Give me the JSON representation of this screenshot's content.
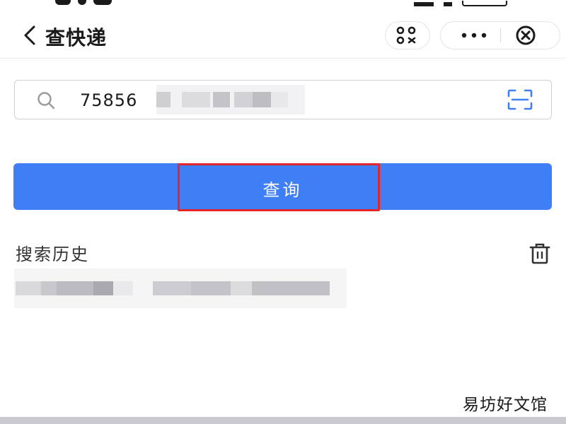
{
  "header": {
    "title": "查快递",
    "back_icon": "chevron-left-icon",
    "mini_program_icon": "grid-scan-icon",
    "more_icon": "more-dots-icon",
    "close_icon": "close-circle-icon"
  },
  "search": {
    "value": "75856",
    "placeholder": "",
    "icon": "search-icon",
    "scan_icon": "scan-icon"
  },
  "actions": {
    "query_label": "查询"
  },
  "history": {
    "title": "搜索历史",
    "clear_icon": "trash-icon"
  },
  "watermark": {
    "text": "易坊好文馆"
  },
  "colors": {
    "primary": "#3f7ef5",
    "highlight": "#e3262b",
    "text": "#1a1a1a"
  }
}
